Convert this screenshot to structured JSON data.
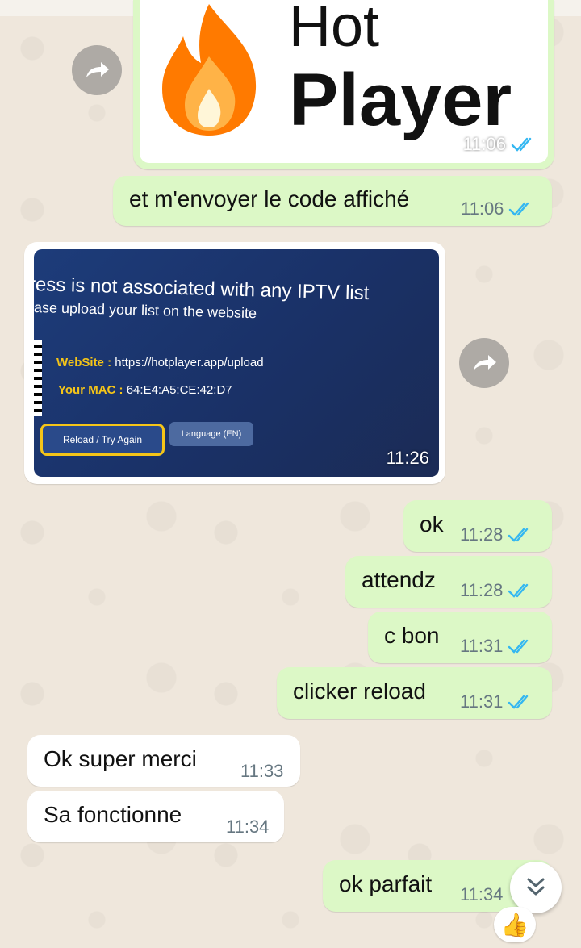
{
  "messages": [
    {
      "text": "et m'envoyer le code affiché",
      "time": "11:06"
    },
    {
      "text": "ok",
      "time": "11:28"
    },
    {
      "text": "attendz",
      "time": "11:28"
    },
    {
      "text": "c bon",
      "time": "11:31"
    },
    {
      "text": "clicker reload",
      "time": "11:31"
    },
    {
      "text": "Ok super merci",
      "time": "11:33"
    },
    {
      "text": "Sa fonctionne",
      "time": "11:34"
    },
    {
      "text": "ok parfait",
      "time": "11:34"
    }
  ],
  "logo_image": {
    "line1": "Hot",
    "line2": "Player",
    "time": "11:06"
  },
  "tv_image": {
    "line1": "ress is not associated with any IPTV list",
    "line2": "ase upload your list on the website",
    "website_label": "WebSite :",
    "website_value": "https://hotplayer.app/upload",
    "mac_label": "Your MAC :",
    "mac_value": "64:E4:A5:CE:42:D7",
    "reload_button": "Reload / Try Again",
    "language_button": "Language (EN)",
    "time": "11:26"
  },
  "reaction": "👍",
  "icons": {
    "forward": "forward-icon",
    "read_receipt": "double-check-icon",
    "scroll_down": "double-chevron-down-icon"
  },
  "colors": {
    "outgoing_bubble": "#dcf8c6",
    "incoming_bubble": "#ffffff",
    "read_tick": "#34b7f1",
    "flame_orange": "#ff7a00"
  }
}
